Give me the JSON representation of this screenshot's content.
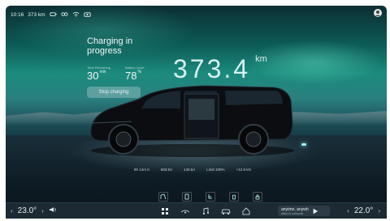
{
  "status": {
    "time": "10:16",
    "range": "373 km"
  },
  "charging": {
    "title": "Charging in progress",
    "time_remaining_label": "Time Remaining",
    "time_remaining_value": "30",
    "time_remaining_unit": "min",
    "battery_label": "Battery Level",
    "battery_value": "78",
    "battery_unit": "%",
    "stop_button": "Stop charging"
  },
  "main_range": {
    "value": "373.4",
    "unit": "km"
  },
  "charge_info": [
    "9h 14m 0",
    "683.5V",
    "140.6A",
    "Limit 100%",
    "+12.8 km"
  ],
  "controls": [
    "door-icon",
    "cabin-icon",
    "seat-icon",
    "bottle-icon",
    "lock-icon"
  ],
  "dock": {
    "left_temp": "23.0",
    "left_deg": "°",
    "right_temp": "22.0",
    "right_deg": "°",
    "media_title": "anytme, anywh",
    "media_sub": "video in surround"
  },
  "colors": {
    "accent": "#7ffff0",
    "brand": "#0d5a56"
  }
}
